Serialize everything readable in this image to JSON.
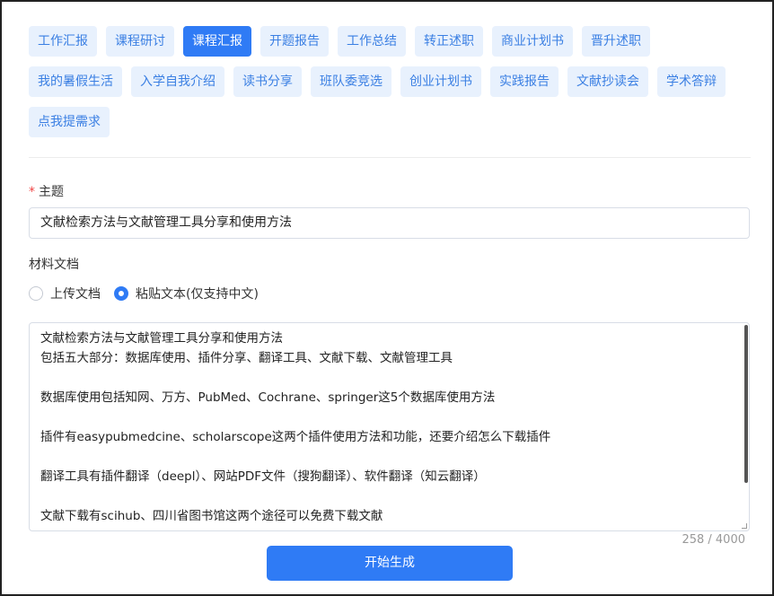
{
  "tags": [
    {
      "label": "工作汇报",
      "active": false
    },
    {
      "label": "课程研讨",
      "active": false
    },
    {
      "label": "课程汇报",
      "active": true
    },
    {
      "label": "开题报告",
      "active": false
    },
    {
      "label": "工作总结",
      "active": false
    },
    {
      "label": "转正述职",
      "active": false
    },
    {
      "label": "商业计划书",
      "active": false
    },
    {
      "label": "晋升述职",
      "active": false
    },
    {
      "label": "我的暑假生活",
      "active": false
    },
    {
      "label": "入学自我介绍",
      "active": false
    },
    {
      "label": "读书分享",
      "active": false
    },
    {
      "label": "班队委竞选",
      "active": false
    },
    {
      "label": "创业计划书",
      "active": false
    },
    {
      "label": "实践报告",
      "active": false
    },
    {
      "label": "文献抄读会",
      "active": false
    },
    {
      "label": "学术答辩",
      "active": false
    },
    {
      "label": "点我提需求",
      "active": false
    }
  ],
  "topic": {
    "required_mark": "*",
    "label": "主题",
    "value": "文献检索方法与文献管理工具分享和使用方法"
  },
  "material": {
    "label": "材料文档",
    "options": [
      {
        "label": "上传文档",
        "selected": false
      },
      {
        "label": "粘贴文本(仅支持中文)",
        "selected": true
      }
    ],
    "text": "文献检索方法与文献管理工具分享和使用方法\n包括五大部分：数据库使用、插件分享、翻译工具、文献下载、文献管理工具\n\n数据库使用包括知网、万方、PubMed、Cochrane、springer这5个数据库使用方法\n\n插件有easypubmedcine、scholarscope这两个插件使用方法和功能，还要介绍怎么下载插件\n\n翻译工具有插件翻译（deepl）、网站PDF文件（搜狗翻译）、软件翻译（知云翻译）\n\n文献下载有scihub、四川省图书馆这两个途径可以免费下载文献",
    "counter": "258 / 4000"
  },
  "submit_label": "开始生成",
  "colors": {
    "accent": "#2f7bf5",
    "tag_bg": "#e8f1fd",
    "tag_text": "#3a7fe3",
    "required": "#f04545"
  }
}
